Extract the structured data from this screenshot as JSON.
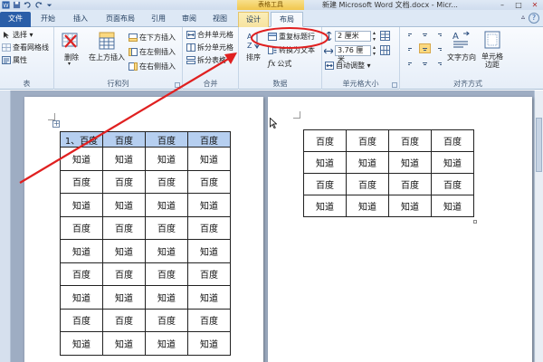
{
  "colors": {
    "file_tab": "#2a5ea8",
    "context_tab": "#f1c64d",
    "selection": "#b6cff0",
    "annotation": "#e02020"
  },
  "titlebar": {
    "context_group": "表格工具",
    "doc_title": "新建 Microsoft Word 文档.docx - Micr...",
    "minimize": "–",
    "maximize": "□",
    "close": "✕"
  },
  "tabs": [
    {
      "label": "文件"
    },
    {
      "label": "开始"
    },
    {
      "label": "插入"
    },
    {
      "label": "页面布局"
    },
    {
      "label": "引用"
    },
    {
      "label": "审阅"
    },
    {
      "label": "视图"
    },
    {
      "label": "设计"
    },
    {
      "label": "布局"
    }
  ],
  "ribbon": {
    "table_group": {
      "label": "表",
      "select": "选择 ▾",
      "gridlines": "查看网格线",
      "properties": "属性"
    },
    "rows_cols_group": {
      "label": "行和列",
      "delete": "删除",
      "insert_above": "在上方插入",
      "insert_below": "在下方插入",
      "insert_left": "在左侧插入",
      "insert_right": "在右侧插入"
    },
    "merge_group": {
      "label": "合并",
      "merge": "合并单元格",
      "split_cells": "拆分单元格",
      "split_table": "拆分表格"
    },
    "data_group": {
      "label": "数据",
      "sort": "排序",
      "repeat_header": "重复标题行",
      "convert": "转换为文本",
      "formula": "公式"
    },
    "cell_size_group": {
      "label": "单元格大小",
      "height": "2 厘米",
      "width": "3.76 厘米",
      "autofit": "自动调整 ▾"
    },
    "alignment_group": {
      "label": "对齐方式",
      "text_direction": "文字方向",
      "cell_margins": "单元格\n边距"
    }
  },
  "doc": {
    "left_table": [
      [
        "1、百度",
        "百度",
        "百度",
        "百度"
      ],
      [
        "知道",
        "知道",
        "知道",
        "知道"
      ],
      [
        "百度",
        "百度",
        "百度",
        "百度"
      ],
      [
        "知道",
        "知道",
        "知道",
        "知道"
      ],
      [
        "百度",
        "百度",
        "百度",
        "百度"
      ],
      [
        "知道",
        "知道",
        "知道",
        "知道"
      ],
      [
        "百度",
        "百度",
        "百度",
        "百度"
      ],
      [
        "知道",
        "知道",
        "知道",
        "知道"
      ],
      [
        "百度",
        "百度",
        "百度",
        "百度"
      ],
      [
        "知道",
        "知道",
        "知道",
        "知道"
      ]
    ],
    "right_table": [
      [
        "百度",
        "百度",
        "百度",
        "百度"
      ],
      [
        "知道",
        "知道",
        "知道",
        "知道"
      ],
      [
        "百度",
        "百度",
        "百度",
        "百度"
      ],
      [
        "知道",
        "知道",
        "知道",
        "知道"
      ]
    ]
  }
}
